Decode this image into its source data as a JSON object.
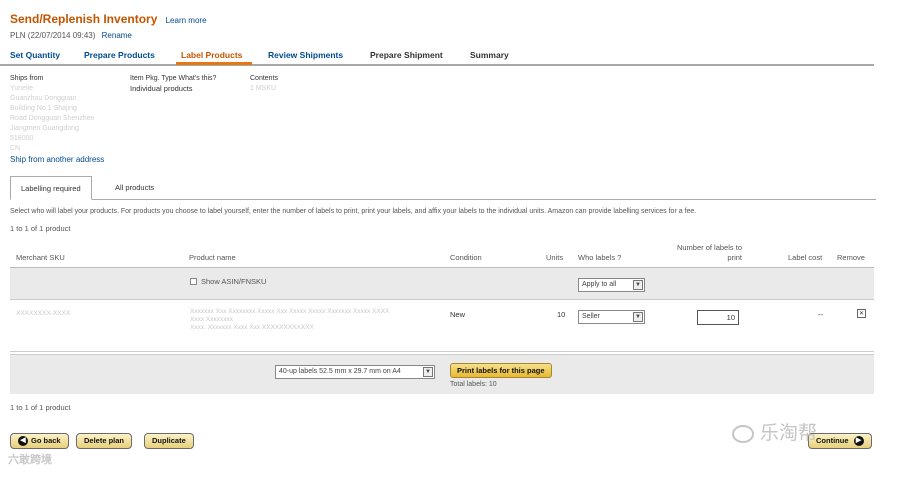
{
  "header": {
    "title": "Send/Replenish Inventory",
    "learn_more": "Learn more",
    "plan_name": "PLN (22/07/2014 09:43)",
    "rename": "Rename"
  },
  "steps": [
    "Set Quantity",
    "Prepare Products",
    "Label Products",
    "Review Shipments",
    "Prepare Shipment",
    "Summary"
  ],
  "info": {
    "ships_from_label": "Ships from",
    "ships_from_lines": [
      "Yunelie",
      "Guanzhou Dongguan",
      "Building No.1 Shajing",
      "Road Dongguan Shenzhen",
      "Jiangmen Guangdong",
      "518000",
      "CN"
    ],
    "pkg_type_label": "Item Pkg. Type",
    "pkg_type_help": "What's this?",
    "pkg_type_value": "Individual products",
    "contents_label": "Contents",
    "contents_value": "1 MSKU",
    "ship_other": "Ship from another address"
  },
  "tabs": [
    "Labelling required",
    "All products"
  ],
  "instructions": "Select who will label your products. For products you choose to label yourself, enter the number of labels to print, print your labels, and affix your labels to the individual units. Amazon can provide labelling services for a fee.",
  "count_text": "1 to 1 of 1 product",
  "columns": {
    "sku": "Merchant SKU",
    "product_name": "Product name",
    "condition": "Condition",
    "units": "Units",
    "who_labels": "Who labels ?",
    "num_labels": "Number of labels to print",
    "label_cost": "Label cost",
    "remove": "Remove"
  },
  "filter": {
    "show_asin": "Show ASIN/FNSKU",
    "apply_all": "Apply to all"
  },
  "item": {
    "sku": "XXXXXXXX-XXXX",
    "product_lines": [
      "Xxxxxxx Xxx Xxxxxxxx Xxxxx Xxx Xxxxx Xxxxx Xxxxxxx Xxxxx XXXX",
      "Xxxx Xxxxxxxx",
      "Xxxx: Xxxxxxx Xxxx Xxx XXXXXXXXXXXX"
    ],
    "condition": "New",
    "units": "10",
    "who_labels": "Seller",
    "num_labels": "10",
    "label_cost": "--"
  },
  "print_row": {
    "label_format": "40-up labels 52.5 mm x 29.7 mm on A4",
    "print_button": "Print labels for this page",
    "total_labels": "Total labels: 10"
  },
  "buttons": {
    "go_back": "Go back",
    "delete_plan": "Delete plan",
    "duplicate": "Duplicate",
    "continue": "Continue"
  },
  "watermarks": {
    "left": "六敢跨境",
    "right": "乐淘帮"
  },
  "colors": {
    "title": "#c45500",
    "link": "#004b91",
    "tab_underline": "#e47911",
    "button_yellow": "#e8b830"
  }
}
